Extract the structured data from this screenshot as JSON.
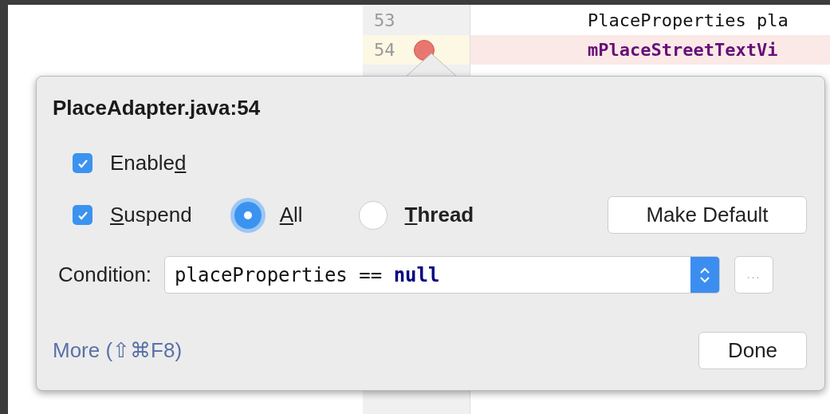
{
  "editor": {
    "lines": [
      {
        "number": "53",
        "code": "PlaceProperties pla",
        "keyword": false,
        "breakpoint": false
      },
      {
        "number": "54",
        "code": "mPlaceStreetTextVi",
        "keyword": true,
        "breakpoint": true
      }
    ]
  },
  "popup": {
    "title": "PlaceAdapter.java:54",
    "enabled": {
      "pre": "Enable",
      "key": "d",
      "checked": true
    },
    "suspend": {
      "key": "S",
      "post": "uspend",
      "checked": true
    },
    "options": [
      {
        "key": "A",
        "post": "ll",
        "selected": true,
        "bold": false
      },
      {
        "key": "T",
        "post": "hread",
        "selected": false,
        "bold": true
      }
    ],
    "make_default": "Make Default",
    "condition": {
      "label": "Condition:",
      "value": "placeProperties == ",
      "keyword": "null"
    },
    "ellipsis": "...",
    "more_link": "More (⇧⌘F8)",
    "done": "Done"
  }
}
